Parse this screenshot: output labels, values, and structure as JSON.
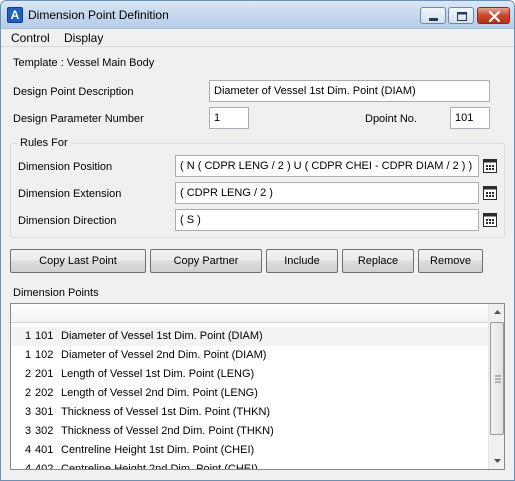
{
  "window": {
    "title": "Dimension Point Definition",
    "icon_letter": "A",
    "minimize_icon": "minimize-icon",
    "maximize_icon": "maximize-icon",
    "close_icon": "close-icon"
  },
  "menu": {
    "items": [
      "Control",
      "Display"
    ]
  },
  "template_label": "Template : Vessel Main Body",
  "design_point": {
    "label": "Design Point Description",
    "value": "Diameter of Vessel 1st Dim. Point (DIAM)"
  },
  "design_parameter": {
    "label": "Design Parameter Number",
    "value": "1"
  },
  "dpoint": {
    "label": "Dpoint No.",
    "value": "101"
  },
  "rules": {
    "title": "Rules For",
    "position": {
      "label": "Dimension Position",
      "value": "( N ( CDPR LENG / 2 ) U ( CDPR CHEI - CDPR DIAM / 2 ) )"
    },
    "extension": {
      "label": "Dimension Extension",
      "value": "( CDPR LENG / 2 )"
    },
    "direction": {
      "label": "Dimension Direction",
      "value": "( S )"
    },
    "picker_icon": "expression-editor-icon"
  },
  "buttons": {
    "copy_last": "Copy Last Point",
    "copy_partner": "Copy Partner",
    "include": "Include",
    "replace": "Replace",
    "remove": "Remove"
  },
  "dimension_points": {
    "label": "Dimension Points",
    "rows": [
      {
        "param": "1",
        "dpoint": "101",
        "desc": "Diameter of Vessel 1st Dim. Point (DIAM)"
      },
      {
        "param": "1",
        "dpoint": "102",
        "desc": "Diameter of Vessel 2nd Dim. Point (DIAM)"
      },
      {
        "param": "2",
        "dpoint": "201",
        "desc": "Length of Vessel 1st Dim. Point (LENG)"
      },
      {
        "param": "2",
        "dpoint": "202",
        "desc": "Length of Vessel 2nd Dim. Point (LENG)"
      },
      {
        "param": "3",
        "dpoint": "301",
        "desc": "Thickness of Vessel 1st Dim. Point (THKN)"
      },
      {
        "param": "3",
        "dpoint": "302",
        "desc": "Thickness of Vessel 2nd Dim. Point (THKN)"
      },
      {
        "param": "4",
        "dpoint": "401",
        "desc": "Centreline Height 1st Dim. Point (CHEI)"
      },
      {
        "param": "4",
        "dpoint": "402",
        "desc": "Centreline Height 2nd Dim. Point (CHEI)"
      }
    ]
  }
}
